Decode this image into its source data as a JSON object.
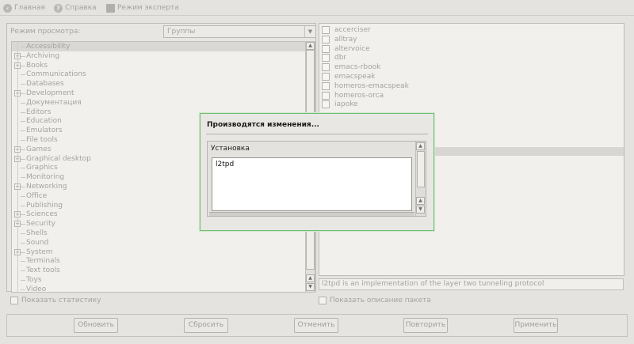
{
  "toolbar": {
    "home": "Главная",
    "help": "Справка",
    "expert": "Режим эксперта"
  },
  "view": {
    "label": "Режим просмотра:",
    "selected": "Группы"
  },
  "groups": [
    {
      "label": "Accessibility",
      "expander": false,
      "selected": true
    },
    {
      "label": "Archiving",
      "expander": true
    },
    {
      "label": "Books",
      "expander": true
    },
    {
      "label": "Communications",
      "expander": false
    },
    {
      "label": "Databases",
      "expander": false
    },
    {
      "label": "Development",
      "expander": true
    },
    {
      "label": "Документация",
      "expander": false
    },
    {
      "label": "Editors",
      "expander": false
    },
    {
      "label": "Education",
      "expander": false
    },
    {
      "label": "Emulators",
      "expander": false
    },
    {
      "label": "File tools",
      "expander": false
    },
    {
      "label": "Games",
      "expander": true
    },
    {
      "label": "Graphical desktop",
      "expander": true
    },
    {
      "label": "Graphics",
      "expander": false
    },
    {
      "label": "Monitoring",
      "expander": false
    },
    {
      "label": "Networking",
      "expander": true
    },
    {
      "label": "Office",
      "expander": false
    },
    {
      "label": "Publishing",
      "expander": false
    },
    {
      "label": "Sciences",
      "expander": true
    },
    {
      "label": "Security",
      "expander": true
    },
    {
      "label": "Shells",
      "expander": false
    },
    {
      "label": "Sound",
      "expander": false
    },
    {
      "label": "System",
      "expander": true
    },
    {
      "label": "Terminals",
      "expander": false
    },
    {
      "label": "Text tools",
      "expander": false
    },
    {
      "label": "Toys",
      "expander": false
    },
    {
      "label": "Video",
      "expander": false
    }
  ],
  "packages": [
    {
      "name": "accerciser"
    },
    {
      "name": "alltray"
    },
    {
      "name": "altervoice"
    },
    {
      "name": "dbr"
    },
    {
      "name": "emacs-rbook"
    },
    {
      "name": "emacspeak"
    },
    {
      "name": "homeros-emacspeak"
    },
    {
      "name": "homeros-orca"
    },
    {
      "name": "iapoke"
    }
  ],
  "description": "l2tpd is an implementation of the layer two tunneling protocol",
  "show_stats": "Показать статистику",
  "show_desc": "Показать описание пакета",
  "buttons": {
    "update": "Обновить",
    "reset": "Сбросить",
    "undo": "Отменить",
    "redo": "Повторить",
    "apply": "Применить"
  },
  "modal": {
    "title": "Производятся изменения...",
    "subtitle": "Установка",
    "text": "l2tpd"
  }
}
